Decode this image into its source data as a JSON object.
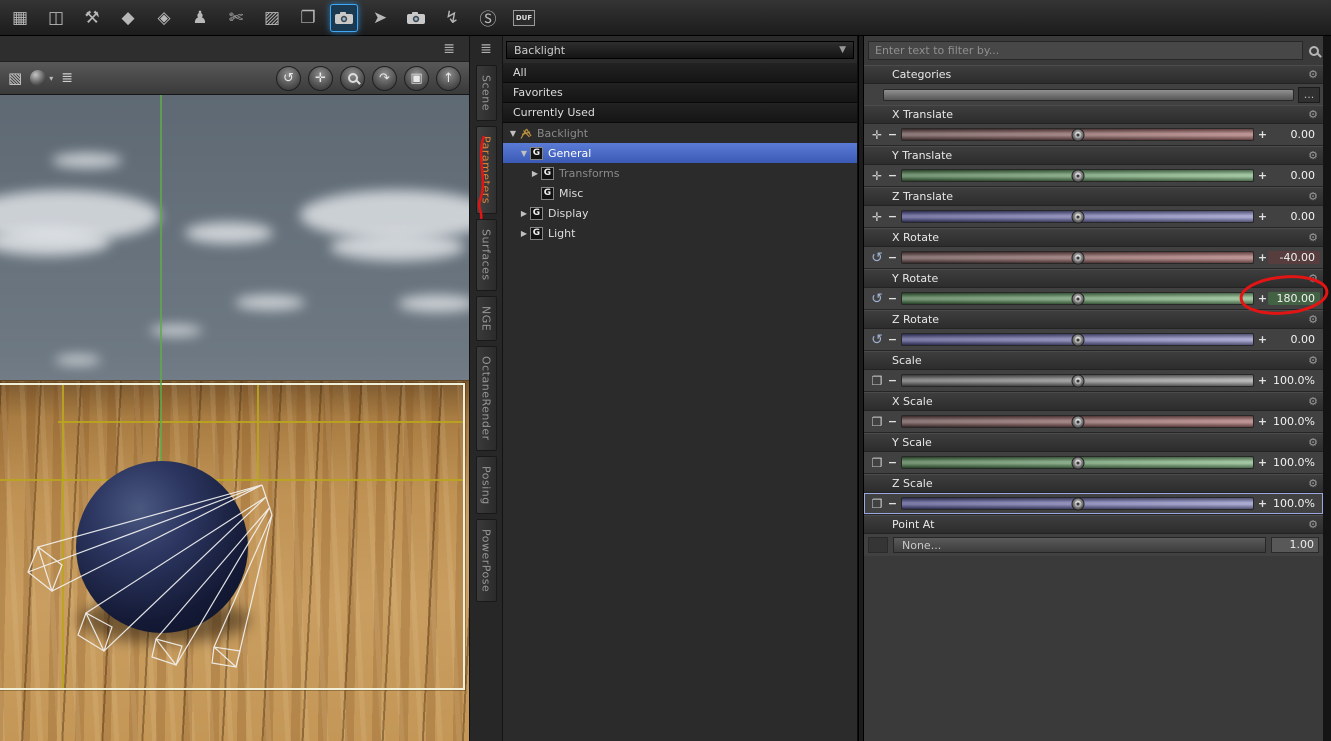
{
  "annotation_color": "#e31414",
  "glyphs": {
    "dropdown_arrow": "▼",
    "dropdown_small": "▾",
    "expander_open": "▼",
    "expander_closed": "▶",
    "minus": "−",
    "plus": "+",
    "gear": "⚙",
    "translate": "✛",
    "rotate": "↺",
    "scale": "❐",
    "pane_menu": "≣",
    "group_icon": "G"
  },
  "top_toolbar": {
    "icons": [
      {
        "name": "clone-tool-icon",
        "glyph": "▦"
      },
      {
        "name": "export-tool-icon",
        "glyph": "◫"
      },
      {
        "name": "tool-settings-icon",
        "glyph": "⚒"
      },
      {
        "name": "morph-tool-icon",
        "glyph": "◆"
      },
      {
        "name": "deformer-tool-icon",
        "glyph": "◈"
      },
      {
        "name": "add-figure-icon",
        "glyph": "♟"
      },
      {
        "name": "cut-tool-icon",
        "glyph": "✄"
      },
      {
        "name": "weight-brush-icon",
        "glyph": "▨"
      },
      {
        "name": "transfer-utility-icon",
        "glyph": "❐"
      },
      {
        "name": "render-icon",
        "glyph": "camera",
        "active": true
      },
      {
        "name": "pointer-tool-icon",
        "glyph": "➤"
      },
      {
        "name": "camera-icon",
        "glyph": "camera"
      },
      {
        "name": "animate-icon",
        "glyph": "↯"
      },
      {
        "name": "smart-content-icon",
        "glyph": "Ⓢ"
      },
      {
        "name": "save-duf-icon",
        "glyph": "duf",
        "label": "DUF"
      }
    ]
  },
  "viewport_toolbar": {
    "cube_glyph": "▧",
    "nav_buttons": [
      {
        "name": "orbit-button",
        "glyph": "↺"
      },
      {
        "name": "pan-button",
        "glyph": "✛"
      },
      {
        "name": "zoom-button",
        "glyph": "mag"
      },
      {
        "name": "rotate-button",
        "glyph": "↷"
      },
      {
        "name": "frame-button",
        "glyph": "▣"
      },
      {
        "name": "reset-view-button",
        "glyph": "↑"
      }
    ]
  },
  "tabs": {
    "items": [
      {
        "label": "Scene"
      },
      {
        "label": "Parameters",
        "active": true
      },
      {
        "label": "Surfaces"
      },
      {
        "label": "NGE"
      },
      {
        "label": "OctaneRender"
      },
      {
        "label": "Posing"
      },
      {
        "label": "PowerPose"
      }
    ]
  },
  "tree": {
    "dropdown_value": "Backlight",
    "filters": [
      "All",
      "Favorites",
      "Currently Used"
    ],
    "nodes": [
      {
        "label": "Backlight",
        "expander": "open",
        "icon": "spotlight",
        "dim": true,
        "indent": 0
      },
      {
        "label": "General",
        "expander": "open",
        "icon": "G",
        "selected": true,
        "indent": 1
      },
      {
        "label": "Transforms",
        "expander": "closed",
        "icon": "G",
        "dim": true,
        "indent": 2
      },
      {
        "label": "Misc",
        "expander": "",
        "icon": "G",
        "indent": 2
      },
      {
        "label": "Display",
        "expander": "closed",
        "icon": "G",
        "indent": 1
      },
      {
        "label": "Light",
        "expander": "closed",
        "icon": "G",
        "indent": 1
      }
    ]
  },
  "params": {
    "filter_placeholder": "Enter text to filter by...",
    "categories_label": "Categories",
    "categories_browse": "...",
    "sliders": [
      {
        "label": "X Translate",
        "value": "0.00",
        "color": "red",
        "icon": "translate",
        "knob": 0.5
      },
      {
        "label": "Y Translate",
        "value": "0.00",
        "color": "green",
        "icon": "translate",
        "knob": 0.5
      },
      {
        "label": "Z Translate",
        "value": "0.00",
        "color": "blue",
        "icon": "translate",
        "knob": 0.5
      },
      {
        "label": "X Rotate",
        "value": "-40.00",
        "color": "red",
        "icon": "rotate",
        "knob": 0.5,
        "value_tint": "red"
      },
      {
        "label": "Y Rotate",
        "value": "180.00",
        "color": "green",
        "icon": "rotate",
        "knob": 0.5,
        "value_tint": "green",
        "annotated": true
      },
      {
        "label": "Z Rotate",
        "value": "0.00",
        "color": "blue",
        "icon": "rotate",
        "knob": 0.5
      },
      {
        "label": "Scale",
        "value": "100.0%",
        "color": "gray",
        "icon": "scale",
        "knob": 0.5
      },
      {
        "label": "X Scale",
        "value": "100.0%",
        "color": "red",
        "icon": "scale",
        "knob": 0.5
      },
      {
        "label": "Y Scale",
        "value": "100.0%",
        "color": "green",
        "icon": "scale",
        "knob": 0.5
      },
      {
        "label": "Z Scale",
        "value": "100.0%",
        "color": "blue",
        "icon": "scale",
        "knob": 0.5,
        "focused": true
      }
    ],
    "point_at": {
      "label": "Point At",
      "value": "None...",
      "number": "1.00"
    }
  }
}
